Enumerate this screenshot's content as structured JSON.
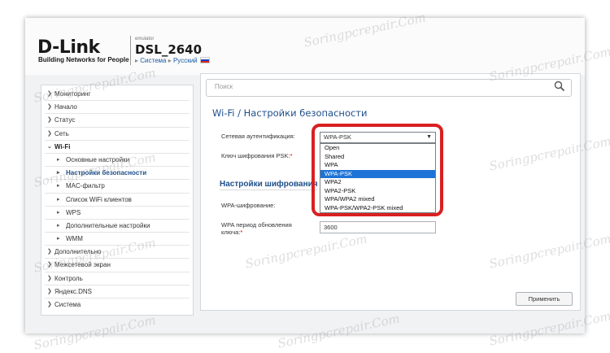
{
  "header": {
    "logo": "D-Link",
    "logo_sub": "Building Networks for People",
    "emulator": "emulator",
    "model": "DSL_2640",
    "breadcrumb": [
      "Система",
      "Русский"
    ]
  },
  "sidebar": {
    "items": [
      {
        "label": "Мониторинг"
      },
      {
        "label": "Начало"
      },
      {
        "label": "Статус"
      },
      {
        "label": "Сеть"
      },
      {
        "label": "Wi-Fi"
      },
      {
        "label": "Основные настройки"
      },
      {
        "label": "Настройки безопасности"
      },
      {
        "label": "MAC-фильтр"
      },
      {
        "label": "Список WiFi клиентов"
      },
      {
        "label": "WPS"
      },
      {
        "label": "Дополнительные настройки"
      },
      {
        "label": "WMM"
      },
      {
        "label": "Дополнительно"
      },
      {
        "label": "Межсетевой экран"
      },
      {
        "label": "Контроль"
      },
      {
        "label": "Яндекс.DNS"
      },
      {
        "label": "Система"
      }
    ]
  },
  "search": {
    "placeholder": "Поиск"
  },
  "page": {
    "title": "Wi-Fi /  Настройки безопасности"
  },
  "form": {
    "auth_label": "Сетевая аутентификация:",
    "key_label": "Ключ шифрования PSK:",
    "section_title": "Настройки шифрования",
    "wpa_enc_label": "WPA-шифрование:",
    "wpa_period_label_1": "WPA период обновления",
    "wpa_period_label_2": "ключа:",
    "wpa_period_value": "3600",
    "req_mark": "*"
  },
  "dropdown": {
    "selected": "WPA-PSK",
    "options": [
      "Open",
      "Shared",
      "WPA",
      "WPA-PSK",
      "WPA2",
      "WPA2-PSK",
      "WPA/WPA2 mixed",
      "WPA-PSK/WPA2-PSK mixed"
    ]
  },
  "buttons": {
    "apply": "Применить"
  },
  "watermark": "Soringpcrepair.Com",
  "colors": {
    "accent": "#1d4e89",
    "highlight": "#d92020",
    "selection": "#1e74d6"
  }
}
